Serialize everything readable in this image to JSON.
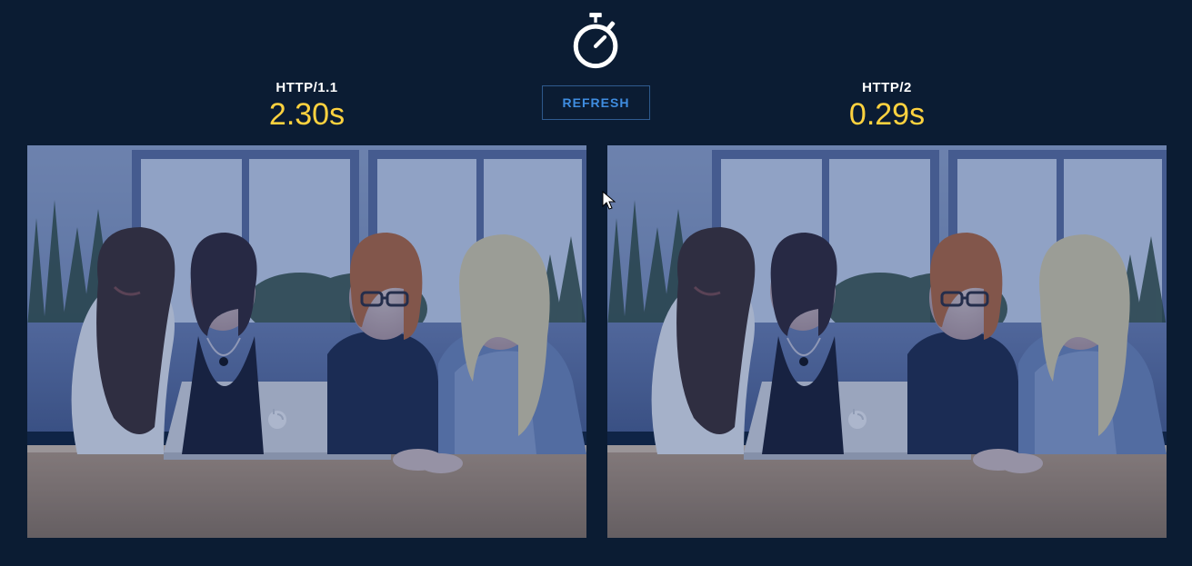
{
  "center": {
    "refresh_label": "REFRESH"
  },
  "left_panel": {
    "label": "HTTP/1.1",
    "time": "2.30s"
  },
  "right_panel": {
    "label": "HTTP/2",
    "time": "0.29s"
  },
  "colors": {
    "accent": "#ffd23f",
    "button_text": "#3f8de0",
    "button_border": "#2f5b8f",
    "background": "#0b1c33"
  },
  "image": {
    "description": "Four women gathered around a silver laptop on a wooden table, green plants and a building window behind them, blue-tinted photo."
  }
}
